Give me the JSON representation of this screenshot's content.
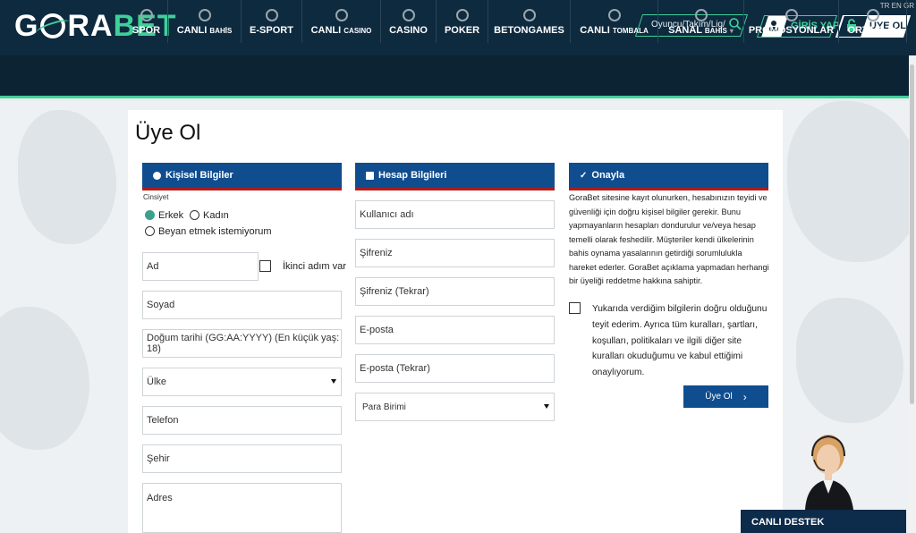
{
  "header": {
    "brand_a": "G",
    "brand_b": "RA",
    "brand_c": "BET",
    "language": "TR EN GR",
    "search_placeholder": "Oyuncu/Takım/Lig/",
    "login_label": "GİRİŞ YAP",
    "register_label": "ÜYE OL"
  },
  "nav": [
    {
      "label": "SPOR",
      "small": "",
      "icon": "football-icon"
    },
    {
      "label": "CANLI",
      "small": "BAHİS",
      "icon": "clock-icon"
    },
    {
      "label": "E-SPORT",
      "small": "",
      "icon": "clock-icon"
    },
    {
      "label": "CANLI",
      "small": "CASINO",
      "icon": "roulette-icon"
    },
    {
      "label": "CASINO",
      "small": "",
      "icon": "chip-icon"
    },
    {
      "label": "POKER",
      "small": "",
      "icon": "cards-icon"
    },
    {
      "label": "BETONGAMES",
      "small": "",
      "icon": "dice-icon"
    },
    {
      "label": "CANLI",
      "small": "TOMBALA",
      "icon": "ball-icon"
    },
    {
      "label": "SANAL",
      "small": "BAHİS",
      "icon": "gamepad-icon"
    },
    {
      "label": "PROMOSYONLAR",
      "small": "",
      "icon": "gift-icon"
    },
    {
      "label": "ORTAKLIK",
      "small": "",
      "icon": "handshake-icon"
    }
  ],
  "page": {
    "title": "Üye Ol"
  },
  "personal": {
    "header": "Kişisel Bilgiler",
    "gender_label": "Cinsiyet",
    "gender_male": "Erkek",
    "gender_female": "Kadın",
    "gender_none": "Beyan etmek istemiyorum",
    "first_name_placeholder": "Ad",
    "second_name_label": "İkinci adım var",
    "last_name_placeholder": "Soyad",
    "birthdate_placeholder": "Doğum tarihi (GG:AA:YYYY) (En küçük yaş: 18)",
    "country_value": "Ülke",
    "phone_placeholder": "Telefon",
    "city_placeholder": "Şehir",
    "address_placeholder": "Adres"
  },
  "account": {
    "header": "Hesap Bilgileri",
    "username_placeholder": "Kullanıcı adı",
    "password_placeholder": "Şifreniz",
    "password_repeat_placeholder": "Şifreniz (Tekrar)",
    "email_placeholder": "E-posta",
    "email_repeat_placeholder": "E-posta (Tekrar)",
    "currency_value": "Para Birimi"
  },
  "confirm": {
    "header": "Onayla",
    "notice": "GoraBet sitesine kayıt olunurken, hesabınızın teyidi ve güvenliği için doğru kişisel bilgiler gerekir. Bunu yapmayanların hesapları dondurulur ve/veya hesap temelli olarak feshedilir. Müşteriler kendi ülkelerinin bahis oynama yasalarının getirdiği sorumlulukla hareket ederler. GoraBet açıklama yapmadan herhangi bir üyeliği reddetme hakkına sahiptir.",
    "terms": "Yukarıda verdiğim bilgilerin doğru olduğunu teyit ederim. Ayrıca tüm kuralları, şartları, koşulları, politikaları ve ilgili diğer site kuralları okuduğumu ve kabul ettiğimi onaylıyorum.",
    "submit_label": "Üye Ol"
  },
  "support": {
    "label": "CANLI DESTEK"
  },
  "colors": {
    "brand_green": "#3fd09a",
    "header_navy": "#0e2a3f",
    "section_blue": "#0f4d8f",
    "accent_red": "#b01c1c"
  }
}
